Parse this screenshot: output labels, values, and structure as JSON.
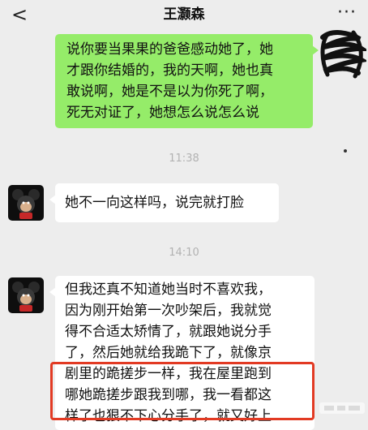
{
  "header": {
    "back_glyph": "<",
    "title": "王灏森",
    "more_glyph": "···"
  },
  "messages": [
    {
      "sender": "me",
      "lines": [
        "说你要当果果的爸爸感动她了，她",
        "才跟你结婚的，我的天啊，她也真",
        "敢说啊，她是不是以为你死了啊，",
        "死无对证了，她想怎么说怎么说"
      ]
    },
    {
      "type": "time",
      "text": "11:38"
    },
    {
      "sender": "other",
      "lines": [
        "她不一向这样吗，说完就打脸"
      ]
    },
    {
      "type": "time",
      "text": "14:10"
    },
    {
      "sender": "other",
      "lines": [
        "但我还真不知道她当时不喜欢我，",
        "因为刚开始第一次吵架后，我就觉",
        "得不合适太矫情了，就跟她说分手",
        "了，然后她就给我跪下了，就像京",
        "剧里的跪搓步一样，我在屋里跑到",
        "哪她跪搓步跟我到哪，我一看都这",
        "样了也狠不下心分手了，就又好上"
      ]
    }
  ],
  "colors": {
    "background": "#ededed",
    "my_bubble": "#95ec69",
    "other_bubble": "#ffffff",
    "highlight_border": "#e23a23",
    "timestamp": "#b2b2b2"
  },
  "icons": [
    "back-icon",
    "more-icon",
    "avatar",
    "scribble-redaction",
    "highlight-box"
  ]
}
